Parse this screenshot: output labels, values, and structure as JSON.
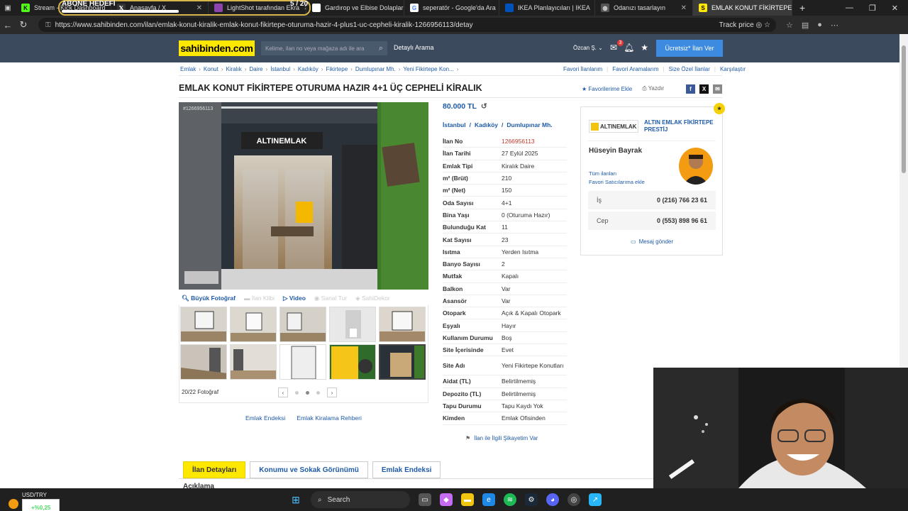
{
  "browser": {
    "tabs": [
      {
        "label": "Stream - Kick Dashboard",
        "fav": "K",
        "fav_color": "#53fc18"
      },
      {
        "label": "Anasayfa / X",
        "fav": "",
        "fav_color": "#333333"
      },
      {
        "label": "LightShot tarafından Ekra",
        "fav": "",
        "fav_color": "#8e44ad"
      },
      {
        "label": "Gardırop ve Elbise Dolapları",
        "fav": "",
        "fav_color": "#ffffff"
      },
      {
        "label": "seperatör - Google'da Ara",
        "fav": "G",
        "fav_color": "#ffffff"
      },
      {
        "label": "IKEA Planlayıcıları | IKEA",
        "fav": "",
        "fav_color": "#0051ba"
      },
      {
        "label": "Odanızı tasarlayın",
        "fav": "",
        "fav_color": "#555555"
      },
      {
        "label": "EMLAK KONUT FİKİRTEPE O",
        "fav": "S",
        "fav_color": "#ffe800"
      }
    ],
    "overlay_title": "ABONE HEDEFİ",
    "overlay_count": "5 / 20",
    "url": "https://www.sahibinden.com/ilan/emlak-konut-kiralik-emlak-konut-fikirtepe-oturuma-hazir-4-plus1-uc-cepheli-kiralik-1266956113/detay",
    "track_price": "Track price"
  },
  "header": {
    "logo": "sahibinden.com",
    "search_placeholder": "Kelime, ilan no veya mağaza adı ile ara",
    "detailed_search": "Detaylı Arama",
    "user": "Özcan Ş.",
    "msg_badge": "3",
    "free_ad": "Ücretsiz* İlan Ver"
  },
  "breadcrumb": [
    "Emlak",
    "Konut",
    "Kiralık",
    "Daire",
    "İstanbul",
    "Kadıköy",
    "Fikirtepe",
    "Dumlupınar Mh.",
    "Yeni Fikirtepe Kon..."
  ],
  "top_links": [
    "Favori İlanlarım",
    "Favori Aramalarım",
    "Size Özel İlanlar",
    "Karşılaştır"
  ],
  "listing": {
    "title": "EMLAK KONUT FİKİRTEPE OTURUMA HAZIR 4+1 ÜÇ CEPHELİ KİRALIK",
    "add_fav": "Favorilerime Ekle",
    "print": "Yazdır",
    "photo_id": "#1266956113",
    "photo_tools": [
      "Büyük Fotoğraf",
      "İlan Klibi",
      "Video",
      "Sanal Tur",
      "SahiDekor"
    ],
    "photo_count": "20/22 Fotoğraf",
    "bottom_links": [
      "Emlak Endeksi",
      "Emlak Kiralama Rehberi"
    ],
    "price": "80.000 TL",
    "location": [
      "İstanbul",
      "Kadıköy",
      "Dumlupınar Mh."
    ],
    "details": [
      {
        "k": "İlan No",
        "v": "1266956113"
      },
      {
        "k": "İlan Tarihi",
        "v": "27 Eylül 2025"
      },
      {
        "k": "Emlak Tipi",
        "v": "Kiralık Daire"
      },
      {
        "k": "m² (Brüt)",
        "v": "210"
      },
      {
        "k": "m² (Net)",
        "v": "150"
      },
      {
        "k": "Oda Sayısı",
        "v": "4+1"
      },
      {
        "k": "Bina Yaşı",
        "v": "0 (Oturuma Hazır)"
      },
      {
        "k": "Bulunduğu Kat",
        "v": "11"
      },
      {
        "k": "Kat Sayısı",
        "v": "23"
      },
      {
        "k": "Isıtma",
        "v": "Yerden Isıtma"
      },
      {
        "k": "Banyo Sayısı",
        "v": "2"
      },
      {
        "k": "Mutfak",
        "v": "Kapalı"
      },
      {
        "k": "Balkon",
        "v": "Var"
      },
      {
        "k": "Asansör",
        "v": "Var"
      },
      {
        "k": "Otopark",
        "v": "Açık & Kapalı Otopark"
      },
      {
        "k": "Eşyalı",
        "v": "Hayır"
      },
      {
        "k": "Kullanım Durumu",
        "v": "Boş"
      },
      {
        "k": "Site İçerisinde",
        "v": "Evet"
      },
      {
        "k": "Site Adı",
        "v": "Yeni Fikirtepe Konutları"
      },
      {
        "k": "Aidat (TL)",
        "v": "Belirtilmemiş"
      },
      {
        "k": "Depozito (TL)",
        "v": "Belirtilmemiş"
      },
      {
        "k": "Tapu Durumu",
        "v": "Tapu Kaydı Yok"
      },
      {
        "k": "Kimden",
        "v": "Emlak Ofisinden"
      }
    ],
    "complaint": "İlan ile İlgili Şikayetim Var"
  },
  "seller": {
    "logo_text": "ALTINEMLAK",
    "store": "ALTIN EMLAK FİKİRTEPE PRESTİJ",
    "agent": "Hüseyin Bayrak",
    "all_ads": "Tüm ilanları",
    "fav_seller": "Favori Satıcılarıma ekle",
    "phones": [
      {
        "k": "İş",
        "v": "0 (216) 766 23 61"
      },
      {
        "k": "Cep",
        "v": "0 (553) 898 96 61"
      }
    ],
    "send_msg": "Mesaj gönder"
  },
  "tabs": [
    "İlan Detayları",
    "Konumu ve Sokak Görünümü",
    "Emlak Endeksi"
  ],
  "description_heading": "Açıklama",
  "taskbar": {
    "pair": "USD/TRY",
    "change": "+%0,25",
    "search": "Search"
  }
}
